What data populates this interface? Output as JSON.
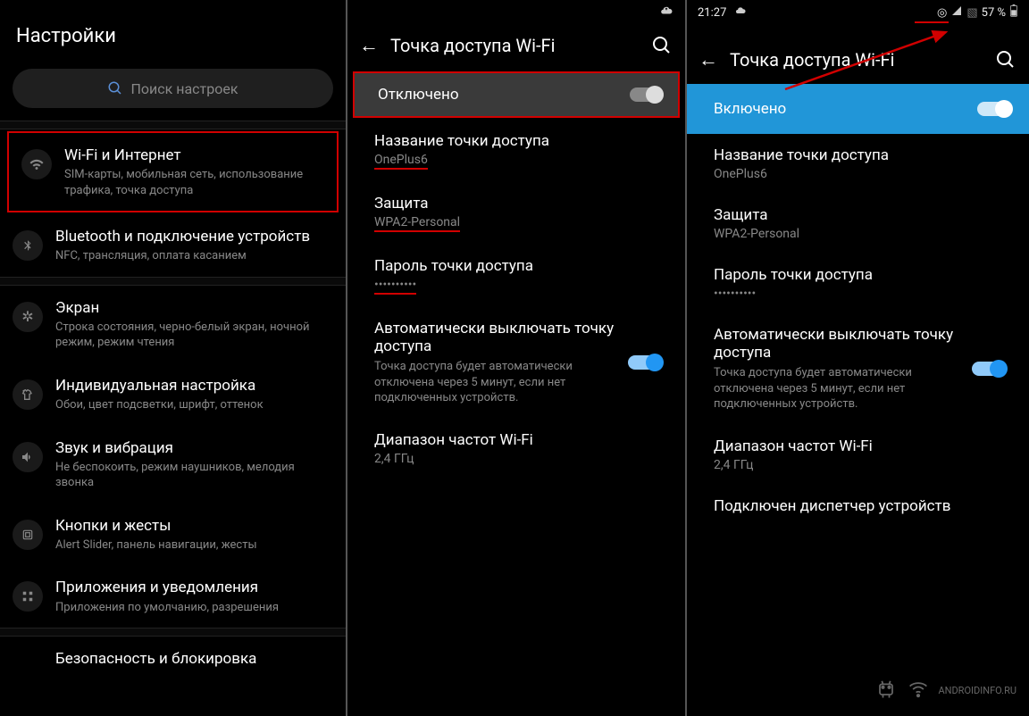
{
  "panel1": {
    "title": "Настройки",
    "search_placeholder": "Поиск настроек",
    "items": [
      {
        "title": "Wi-Fi и Интернет",
        "sub": "SIM-карты, мобильная сеть, использование трафика, точка доступа"
      },
      {
        "title": "Bluetooth и подключение устройств",
        "sub": "NFC, трансляция, оплата касанием"
      },
      {
        "title": "Экран",
        "sub": "Строка состояния, черно-белый экран, ночной режим, режим чтения"
      },
      {
        "title": "Индивидуальная настройка",
        "sub": "Обои, цвет подсветки, шрифт, оттенок"
      },
      {
        "title": "Звук и вибрация",
        "sub": "Не беспокоить, режим наушников, мелодия звонка"
      },
      {
        "title": "Кнопки и жесты",
        "sub": "Alert Slider, панель навигации, жесты"
      },
      {
        "title": "Приложения и уведомления",
        "sub": "Приложения по умолчанию, разрешения"
      },
      {
        "title": "Безопасность и блокировка",
        "sub": ""
      }
    ]
  },
  "panel2": {
    "header": "Точка доступа Wi-Fi",
    "toggle_label": "Отключено",
    "hotspot_name_label": "Название точки доступа",
    "hotspot_name_value": "OnePlus6",
    "security_label": "Защита",
    "security_value": "WPA2-Personal",
    "password_label": "Пароль точки доступа",
    "password_value": "••••••••••",
    "auto_off_title": "Автоматически выключать точку доступа",
    "auto_off_desc": "Точка доступа будет автоматически отключена через 5 минут, если нет подключенных устройств.",
    "band_label": "Диапазон частот Wi-Fi",
    "band_value": "2,4 ГГц"
  },
  "panel3": {
    "status_time": "21:27",
    "status_battery": "57 %",
    "header": "Точка доступа Wi-Fi",
    "toggle_label": "Включено",
    "hotspot_name_label": "Название точки доступа",
    "hotspot_name_value": "OnePlus6",
    "security_label": "Защита",
    "security_value": "WPA2-Personal",
    "password_label": "Пароль точки доступа",
    "password_value": "••••••••••",
    "auto_off_title": "Автоматически выключать точку доступа",
    "auto_off_desc": "Точка доступа будет автоматически отключена через 5 минут, если нет подключенных устройств.",
    "band_label": "Диапазон частот Wi-Fi",
    "band_value": "2,4 ГГц",
    "extra": "Подключен диспетчер устройств"
  },
  "watermark": "ANDROIDINFO.RU"
}
